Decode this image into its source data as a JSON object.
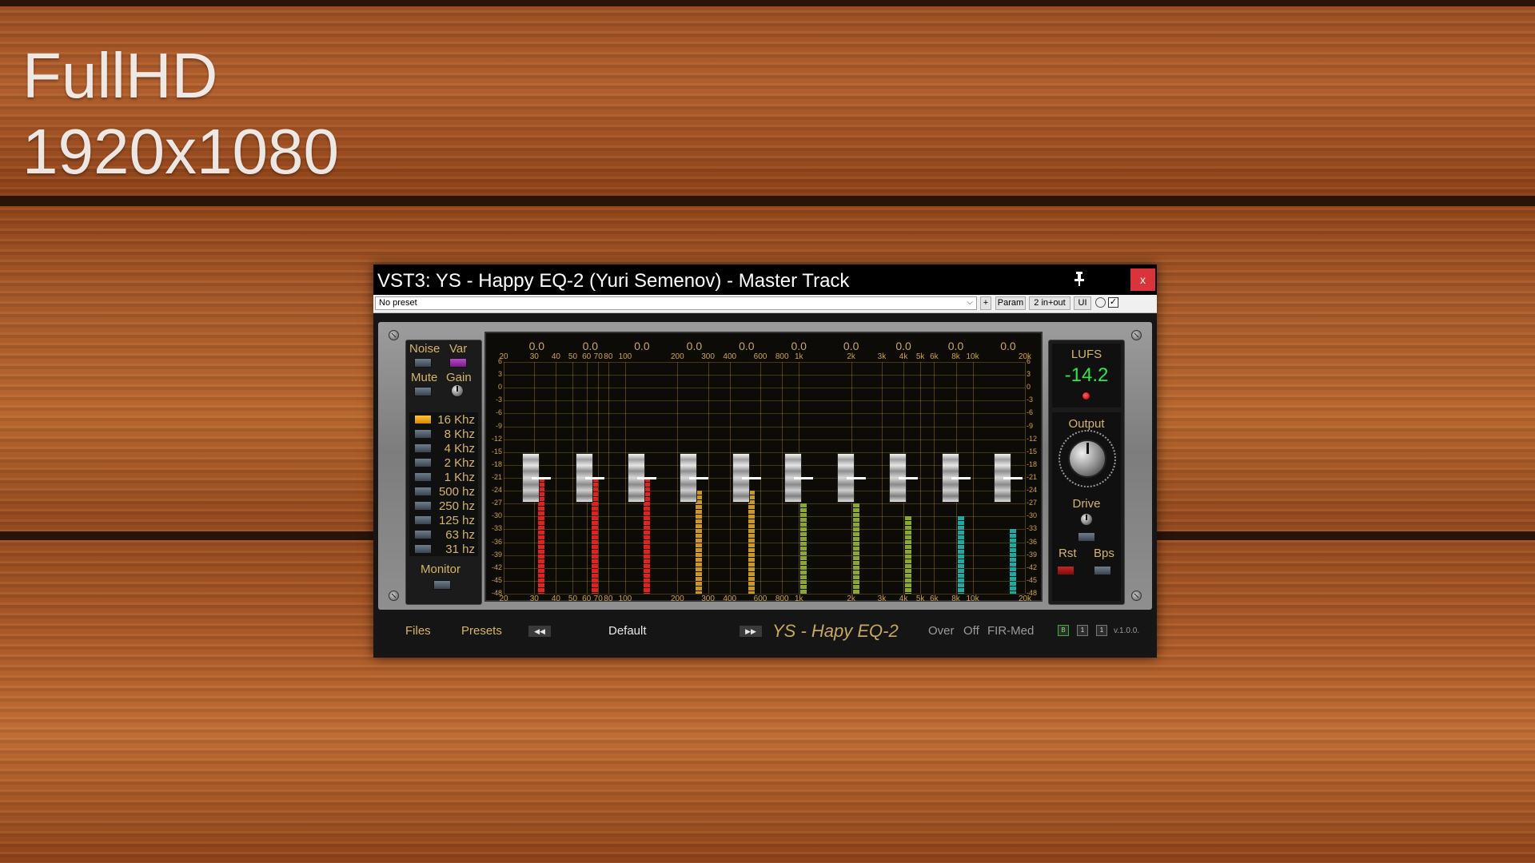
{
  "desktop": {
    "title_line1": "FullHD",
    "title_line2": "1920x1080"
  },
  "window": {
    "title": "VST3: YS - Happy EQ-2 (Yuri Semenov) - Master Track",
    "close_label": "x"
  },
  "toolbar": {
    "preset_value": "No preset",
    "plus_label": "+",
    "param_label": "Param",
    "io_label": "2 in+out",
    "ui_label": "UI",
    "check_label": "✓"
  },
  "left_panel": {
    "noise_label": "Noise",
    "var_label": "Var",
    "mute_label": "Mute",
    "gain_label": "Gain",
    "monitor_label": "Monitor",
    "freqs": [
      {
        "label": "16 Khz",
        "active": true
      },
      {
        "label": "8 Khz",
        "active": false
      },
      {
        "label": "4 Khz",
        "active": false
      },
      {
        "label": "2 Khz",
        "active": false
      },
      {
        "label": "1 Khz",
        "active": false
      },
      {
        "label": "500 hz",
        "active": false
      },
      {
        "label": "250 hz",
        "active": false
      },
      {
        "label": "125 hz",
        "active": false
      },
      {
        "label": "63 hz",
        "active": false
      },
      {
        "label": "31 hz",
        "active": false
      }
    ]
  },
  "eq": {
    "band_values": [
      "0.0",
      "0.0",
      "0.0",
      "0.0",
      "0.0",
      "0.0",
      "0.0",
      "0.0",
      "0.0",
      "0.0"
    ],
    "db_scale": [
      "6",
      "3",
      "0",
      "-3",
      "-6",
      "-9",
      "-12",
      "-15",
      "-18",
      "-21",
      "-24",
      "-27",
      "-30",
      "-33",
      "-36",
      "-39",
      "-42",
      "-45",
      "-48"
    ],
    "freq_scale": [
      "20",
      "30",
      "40",
      "50",
      "60",
      "70",
      "80",
      "100",
      "200",
      "300",
      "400",
      "600",
      "800",
      "1k",
      "2k",
      "3k",
      "4k",
      "5k",
      "6k",
      "8k",
      "10k",
      "20k"
    ],
    "meter_levels": [
      -21,
      -21,
      -21,
      -24,
      -24,
      -27,
      -27,
      -30,
      -30,
      -33
    ],
    "meter_colors": [
      "#e0221f",
      "#e0221f",
      "#e0221f",
      "#c8952e",
      "#c8952e",
      "#8aa830",
      "#8aa830",
      "#8aa830",
      "#22a6a0",
      "#22a6a0"
    ]
  },
  "right_panel": {
    "lufs_label": "LUFS",
    "lufs_value": "-14.2",
    "output_label": "Output",
    "drive_label": "Drive",
    "rst_label": "Rst",
    "bps_label": "Bps"
  },
  "footer": {
    "files_label": "Files",
    "presets_label": "Presets",
    "prev_label": "◀◀",
    "preset_name": "Default",
    "next_label": "▶▶",
    "product_name": "YS - Hapy EQ-2",
    "over_label": "Over",
    "off_label": "Off",
    "fir_label": "FIR-Med",
    "b_label": "B",
    "one_a_label": "1",
    "one_b_label": "1",
    "version": "v.1.0.0."
  }
}
